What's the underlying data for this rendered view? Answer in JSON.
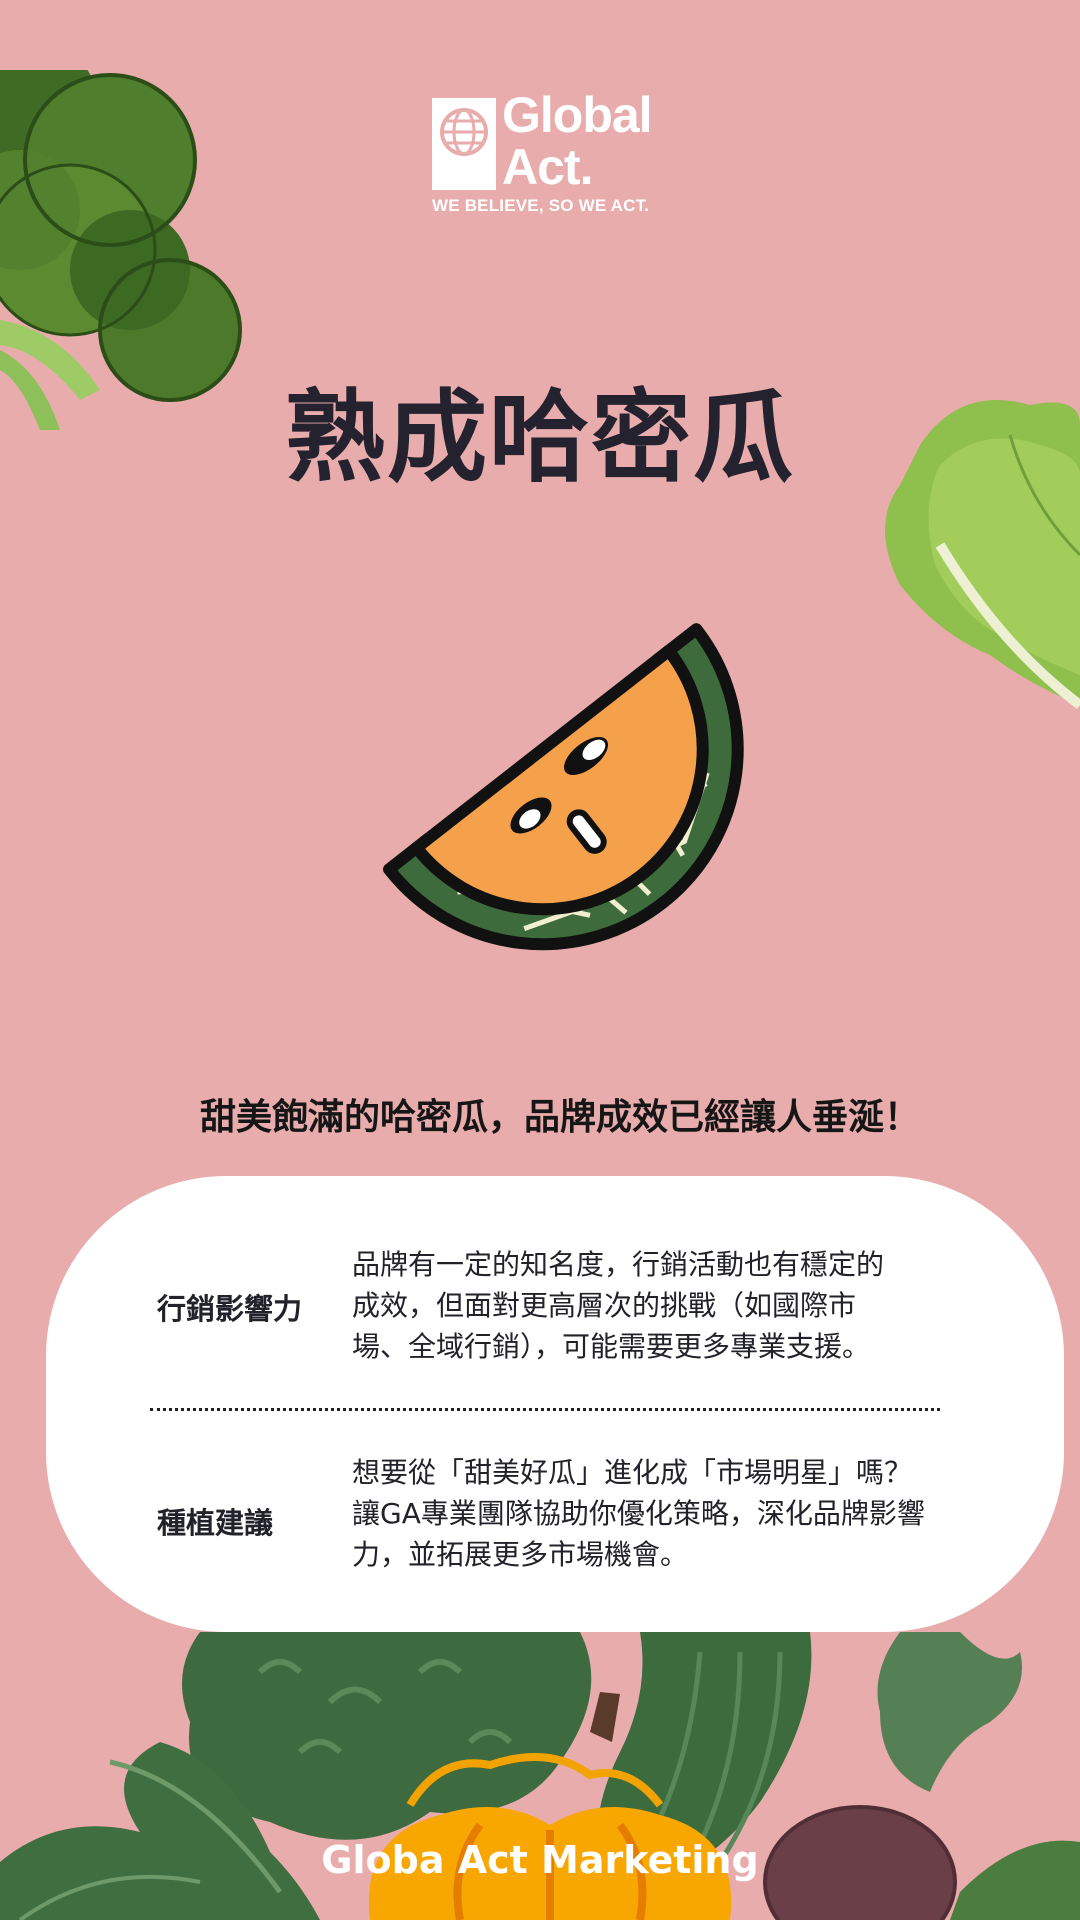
{
  "brand": {
    "logo_line1": "Global",
    "logo_line2": "Act.",
    "slogan": "WE BELIEVE, SO WE ACT."
  },
  "title": "熟成哈密瓜",
  "tagline": "甜美飽滿的哈密瓜，品牌成效已經讓人垂涎！",
  "details": [
    {
      "label": "行銷影響力",
      "lines": [
        "品牌有一定的知名度，行銷活動也有穩定的",
        "成效，但面對更高層次的挑戰（如國際市",
        "場、全域行銷），可能需要更多專業支援。"
      ]
    },
    {
      "label": "種植建議",
      "lines": [
        "想要從「甜美好瓜」進化成「市場明星」嗎？",
        "讓GA專業團隊協助你優化策略，深化品牌影響",
        "力，並拓展更多市場機會。"
      ]
    }
  ],
  "footer": "Globa Act Marketing",
  "colors": {
    "background": "#e9acac",
    "title": "#23222e",
    "melon_flesh": "#f5a04a",
    "melon_rind": "#3e6b3b",
    "card": "#ffffff"
  },
  "icons": [
    "globe-icon",
    "broccoli-illustration",
    "lettuce-illustration",
    "melon-character-illustration",
    "vegetables-illustration",
    "pumpkin-illustration"
  ]
}
